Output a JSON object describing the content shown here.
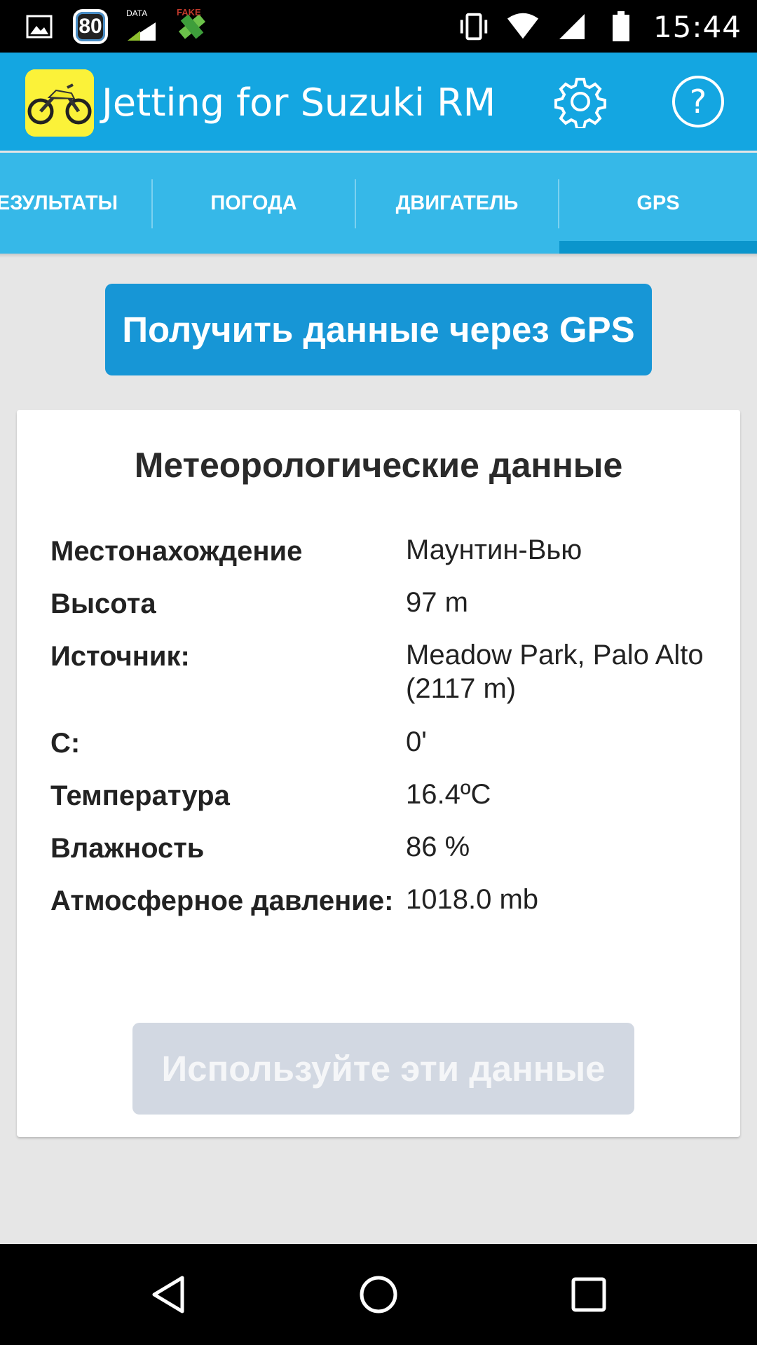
{
  "status_bar": {
    "time": "15:44",
    "left_icons": [
      "image-icon",
      "badge-80-icon",
      "data-icon",
      "fake-gps-icon"
    ],
    "badge_text": "80",
    "data_label": "DATA",
    "fake_label": "FAKE",
    "right_icons": [
      "vibrate-icon",
      "wifi-icon",
      "signal-icon",
      "battery-icon"
    ]
  },
  "app_bar": {
    "title": "Jetting for Suzuki RM",
    "settings_icon": "gear-icon",
    "help_icon": "help-icon",
    "help_glyph": "?"
  },
  "tabs": [
    {
      "label": "ЕЗУЛЬТАТЫ",
      "selected": false
    },
    {
      "label": "ПОГОДА",
      "selected": false
    },
    {
      "label": "ДВИГАТЕЛЬ",
      "selected": false
    },
    {
      "label": "GPS",
      "selected": true
    }
  ],
  "gps_button": {
    "label": "Получить данные через GPS"
  },
  "weather": {
    "title": "Метеорологические данные",
    "rows": [
      {
        "label": "Местонахождение",
        "value": "Маунтин-Вью"
      },
      {
        "label": "Высота",
        "value": "97 m"
      },
      {
        "label": "Источник:",
        "value": "Meadow Park, Palo Alto (2117 m)"
      },
      {
        "label": "С:",
        "value": "0'"
      },
      {
        "label": "Температура",
        "value": "16.4ºC"
      },
      {
        "label": "Влажность",
        "value": "86 %"
      },
      {
        "label": "Атмосферное давление:",
        "value": "1018.0 mb"
      }
    ]
  },
  "use_button": {
    "label": "Используйте эти данные",
    "enabled": false
  },
  "nav_bar": {
    "icons": [
      "back-icon",
      "home-icon",
      "recents-icon"
    ]
  },
  "colors": {
    "app_bar": "#14a6e1",
    "tab_bar": "#36b8e8",
    "tab_indicator": "#0b95cc",
    "primary_button": "#1796d6",
    "disabled_button": "#d2d8e2",
    "background": "#e6e6e6"
  }
}
